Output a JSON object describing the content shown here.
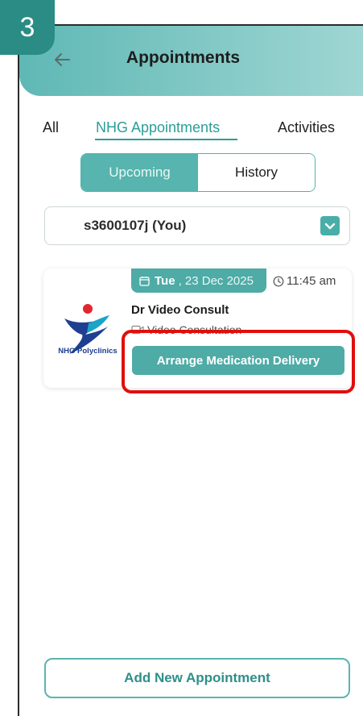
{
  "step_badge": "3",
  "header": {
    "title": "Appointments"
  },
  "tabs": [
    {
      "label": "All"
    },
    {
      "label": "NHG Appointments"
    },
    {
      "label": "Activities"
    }
  ],
  "segment": {
    "upcoming": "Upcoming",
    "history": "History"
  },
  "patient": {
    "selected": "s3600107j (You)"
  },
  "appointment": {
    "day": "Tue",
    "date": ", 23 Dec 2025",
    "time": "11:45 am",
    "doctor": "Dr Video Consult",
    "type": "Video Consultation",
    "clinic_logo_text": "NHG Polyclinics",
    "action_label": "Arrange Medication Delivery"
  },
  "footer": {
    "add_label": "Add New Appointment"
  },
  "colors": {
    "accent": "#4eaba6",
    "highlight": "#e10e0e",
    "badge": "#2a8c84"
  }
}
